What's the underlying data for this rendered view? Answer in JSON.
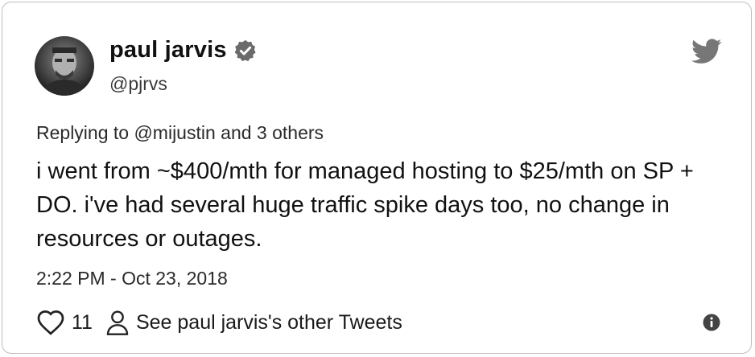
{
  "author": {
    "name": "paul jarvis",
    "handle": "@pjrvs"
  },
  "reply": {
    "text": "Replying to @mijustin and 3 others"
  },
  "tweet": {
    "text": "i went from ~$400/mth for managed hosting to $25/mth on SP + DO. i've had several huge traffic spike days too, no change in resources or outages.",
    "timestamp": "2:22 PM - Oct 23, 2018"
  },
  "actions": {
    "likes": "11",
    "other_tweets": "See paul jarvis's other Tweets"
  },
  "icons": [
    "verified-badge-icon",
    "twitter-bird-icon",
    "heart-icon",
    "person-icon",
    "info-icon"
  ]
}
